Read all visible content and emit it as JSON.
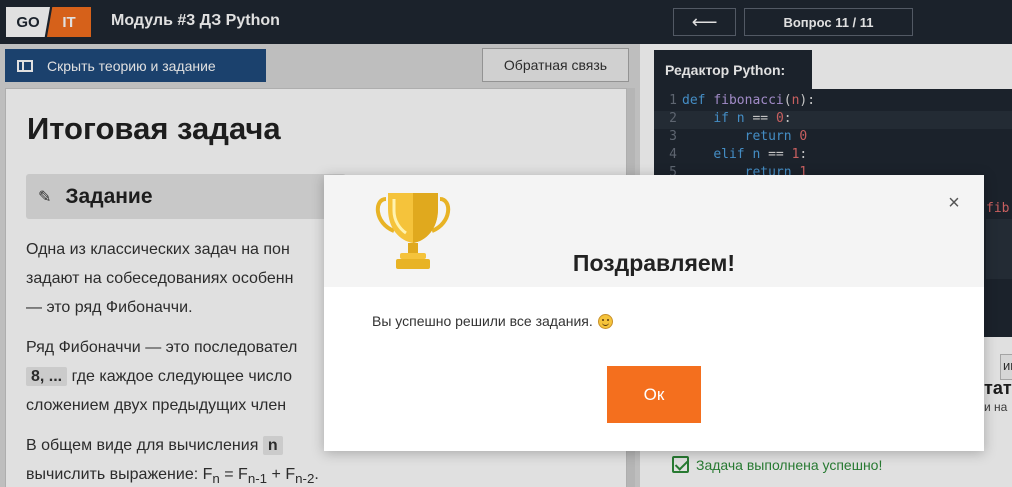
{
  "topbar": {
    "logo_left": "GO",
    "logo_right": "IT",
    "module_title": "Модуль #3 ДЗ Python",
    "back_arrow": "⟵",
    "question_counter": "Вопрос 11 / 11",
    "colors": {
      "bg": "#1f2732",
      "accent": "#f46f1e"
    }
  },
  "left": {
    "hide_button": "Скрыть теорию и задание",
    "feedback_button": "Обратная связь",
    "page_title": "Итоговая задача",
    "task_header": "Задание",
    "paragraphs": [
      [
        "Одна из классических задач на пон",
        "задают на собеседованиях особенн",
        "— это ряд Фибоначчи."
      ],
      [
        "Ряд Фибоначчи — это последовател"
      ],
      [
        "сложением двух предыдущих член"
      ]
    ],
    "p2_chip": "8, ...",
    "p2_line2": "где каждое следующее число",
    "p3_line1_pre": "В общем виде для вычисления",
    "p3_chip": "n",
    "p3_line2": "вычислить выражение: F",
    "formula_sub_n": "n",
    "formula_eq": " = F",
    "formula_sub_n1": "n-1",
    "formula_plus": " + F",
    "formula_sub_n2": "n-2",
    "formula_end": "."
  },
  "right": {
    "editor_tab": "Редактор Python:",
    "code_lines": [
      "def fibonacci(n):",
      "    if n == 0:",
      "        return 0",
      "    elif n == 1:",
      "        return 1"
    ],
    "line_numbers": [
      "1",
      "2",
      "3",
      "4",
      "5"
    ],
    "peek_fib": "fib",
    "peek_tab": "ию",
    "peek_result": "тат",
    "peek_sub": "и на",
    "success_text": "Задача выполнена успешно!"
  },
  "modal": {
    "title": "Поздравляем!",
    "message": "Вы успешно решили все задания.",
    "ok_button": "Ок",
    "close_icon": "×",
    "trophy_icon": "trophy-icon",
    "smile_icon": "smiley-icon"
  }
}
